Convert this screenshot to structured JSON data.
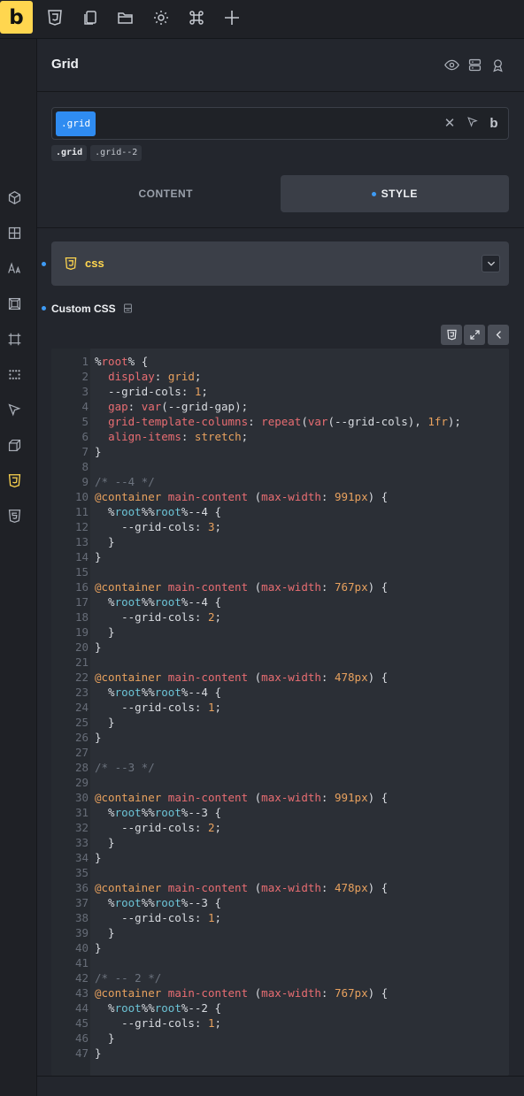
{
  "app": {
    "logo_text": "b"
  },
  "toolbar": {
    "icons": [
      "css3-shield-icon",
      "pages-icon",
      "folder-icon",
      "settings-gear-icon",
      "command-icon",
      "add-plus-icon"
    ]
  },
  "rail": {
    "icons": [
      "cube-icon",
      "layout-icon",
      "typography-icon",
      "spacing-icon",
      "frame-icon",
      "grid-dots-icon",
      "cursor-icon",
      "box-3d-icon",
      "css3-icon",
      "html5-icon"
    ],
    "active_index": 8
  },
  "panel": {
    "title": "Grid",
    "selector_chip": ".grid",
    "selector_b": "b",
    "class_chips": [
      ".grid",
      ".grid--2"
    ],
    "tabs": {
      "content": "CONTENT",
      "style": "STYLE"
    },
    "css_section_label": "css",
    "custom_css_label": "Custom CSS"
  },
  "code": [
    [
      [
        "t-default",
        "%"
      ],
      [
        "t-red",
        "root"
      ],
      [
        "t-default",
        "% {"
      ]
    ],
    [
      [
        "t-default",
        "  "
      ],
      [
        "t-red",
        "display"
      ],
      [
        "t-default",
        ": "
      ],
      [
        "t-orange",
        "grid"
      ],
      [
        "t-default",
        ";"
      ]
    ],
    [
      [
        "t-default",
        "  --grid-cols: "
      ],
      [
        "t-orange",
        "1"
      ],
      [
        "t-default",
        ";"
      ]
    ],
    [
      [
        "t-default",
        "  "
      ],
      [
        "t-red",
        "gap"
      ],
      [
        "t-default",
        ": "
      ],
      [
        "t-red",
        "var"
      ],
      [
        "t-default",
        "(--grid-gap);"
      ]
    ],
    [
      [
        "t-default",
        "  "
      ],
      [
        "t-red",
        "grid-template-columns"
      ],
      [
        "t-default",
        ": "
      ],
      [
        "t-red",
        "repeat"
      ],
      [
        "t-default",
        "("
      ],
      [
        "t-red",
        "var"
      ],
      [
        "t-default",
        "(--grid-cols), "
      ],
      [
        "t-orange",
        "1fr"
      ],
      [
        "t-default",
        ");"
      ]
    ],
    [
      [
        "t-default",
        "  "
      ],
      [
        "t-red",
        "align-items"
      ],
      [
        "t-default",
        ": "
      ],
      [
        "t-orange",
        "stretch"
      ],
      [
        "t-default",
        ";"
      ]
    ],
    [
      [
        "t-default",
        "}"
      ]
    ],
    [],
    [
      [
        "t-comment",
        "/* --4 */"
      ]
    ],
    [
      [
        "t-orange",
        "@container"
      ],
      [
        "t-default",
        " "
      ],
      [
        "t-red",
        "main-content"
      ],
      [
        "t-default",
        " ("
      ],
      [
        "t-red",
        "max-width"
      ],
      [
        "t-default",
        ": "
      ],
      [
        "t-orange",
        "991px"
      ],
      [
        "t-default",
        ") {"
      ]
    ],
    [
      [
        "t-default",
        "  %"
      ],
      [
        "t-cyan",
        "root"
      ],
      [
        "t-default",
        "%%"
      ],
      [
        "t-cyan",
        "root"
      ],
      [
        "t-default",
        "%--4 {"
      ]
    ],
    [
      [
        "t-default",
        "    --grid-cols: "
      ],
      [
        "t-orange",
        "3"
      ],
      [
        "t-default",
        ";"
      ]
    ],
    [
      [
        "t-default",
        "  }"
      ]
    ],
    [
      [
        "t-default",
        "}"
      ]
    ],
    [],
    [
      [
        "t-orange",
        "@container"
      ],
      [
        "t-default",
        " "
      ],
      [
        "t-red",
        "main-content"
      ],
      [
        "t-default",
        " ("
      ],
      [
        "t-red",
        "max-width"
      ],
      [
        "t-default",
        ": "
      ],
      [
        "t-orange",
        "767px"
      ],
      [
        "t-default",
        ") {"
      ]
    ],
    [
      [
        "t-default",
        "  %"
      ],
      [
        "t-cyan",
        "root"
      ],
      [
        "t-default",
        "%%"
      ],
      [
        "t-cyan",
        "root"
      ],
      [
        "t-default",
        "%--4 {"
      ]
    ],
    [
      [
        "t-default",
        "    --grid-cols: "
      ],
      [
        "t-orange",
        "2"
      ],
      [
        "t-default",
        ";"
      ]
    ],
    [
      [
        "t-default",
        "  }"
      ]
    ],
    [
      [
        "t-default",
        "}"
      ]
    ],
    [],
    [
      [
        "t-orange",
        "@container"
      ],
      [
        "t-default",
        " "
      ],
      [
        "t-red",
        "main-content"
      ],
      [
        "t-default",
        " ("
      ],
      [
        "t-red",
        "max-width"
      ],
      [
        "t-default",
        ": "
      ],
      [
        "t-orange",
        "478px"
      ],
      [
        "t-default",
        ") {"
      ]
    ],
    [
      [
        "t-default",
        "  %"
      ],
      [
        "t-cyan",
        "root"
      ],
      [
        "t-default",
        "%%"
      ],
      [
        "t-cyan",
        "root"
      ],
      [
        "t-default",
        "%--4 {"
      ]
    ],
    [
      [
        "t-default",
        "    --grid-cols: "
      ],
      [
        "t-orange",
        "1"
      ],
      [
        "t-default",
        ";"
      ]
    ],
    [
      [
        "t-default",
        "  }"
      ]
    ],
    [
      [
        "t-default",
        "}"
      ]
    ],
    [],
    [
      [
        "t-comment",
        "/* --3 */"
      ]
    ],
    [],
    [
      [
        "t-orange",
        "@container"
      ],
      [
        "t-default",
        " "
      ],
      [
        "t-red",
        "main-content"
      ],
      [
        "t-default",
        " ("
      ],
      [
        "t-red",
        "max-width"
      ],
      [
        "t-default",
        ": "
      ],
      [
        "t-orange",
        "991px"
      ],
      [
        "t-default",
        ") {"
      ]
    ],
    [
      [
        "t-default",
        "  %"
      ],
      [
        "t-cyan",
        "root"
      ],
      [
        "t-default",
        "%%"
      ],
      [
        "t-cyan",
        "root"
      ],
      [
        "t-default",
        "%--3 {"
      ]
    ],
    [
      [
        "t-default",
        "    --grid-cols: "
      ],
      [
        "t-orange",
        "2"
      ],
      [
        "t-default",
        ";"
      ]
    ],
    [
      [
        "t-default",
        "  }"
      ]
    ],
    [
      [
        "t-default",
        "}"
      ]
    ],
    [],
    [
      [
        "t-orange",
        "@container"
      ],
      [
        "t-default",
        " "
      ],
      [
        "t-red",
        "main-content"
      ],
      [
        "t-default",
        " ("
      ],
      [
        "t-red",
        "max-width"
      ],
      [
        "t-default",
        ": "
      ],
      [
        "t-orange",
        "478px"
      ],
      [
        "t-default",
        ") {"
      ]
    ],
    [
      [
        "t-default",
        "  %"
      ],
      [
        "t-cyan",
        "root"
      ],
      [
        "t-default",
        "%%"
      ],
      [
        "t-cyan",
        "root"
      ],
      [
        "t-default",
        "%--3 {"
      ]
    ],
    [
      [
        "t-default",
        "    --grid-cols: "
      ],
      [
        "t-orange",
        "1"
      ],
      [
        "t-default",
        ";"
      ]
    ],
    [
      [
        "t-default",
        "  }"
      ]
    ],
    [
      [
        "t-default",
        "}"
      ]
    ],
    [],
    [
      [
        "t-comment",
        "/* -- 2 */"
      ]
    ],
    [
      [
        "t-orange",
        "@container"
      ],
      [
        "t-default",
        " "
      ],
      [
        "t-red",
        "main-content"
      ],
      [
        "t-default",
        " ("
      ],
      [
        "t-red",
        "max-width"
      ],
      [
        "t-default",
        ": "
      ],
      [
        "t-orange",
        "767px"
      ],
      [
        "t-default",
        ") {"
      ]
    ],
    [
      [
        "t-default",
        "  %"
      ],
      [
        "t-cyan",
        "root"
      ],
      [
        "t-default",
        "%%"
      ],
      [
        "t-cyan",
        "root"
      ],
      [
        "t-default",
        "%--2 {"
      ]
    ],
    [
      [
        "t-default",
        "    --grid-cols: "
      ],
      [
        "t-orange",
        "1"
      ],
      [
        "t-default",
        ";"
      ]
    ],
    [
      [
        "t-default",
        "  }"
      ]
    ],
    [
      [
        "t-default",
        "}"
      ]
    ]
  ],
  "colors": {
    "accent": "#ffd64f",
    "selection_blue": "#2f8cf1",
    "indicator_dot": "#3e9bf5"
  }
}
